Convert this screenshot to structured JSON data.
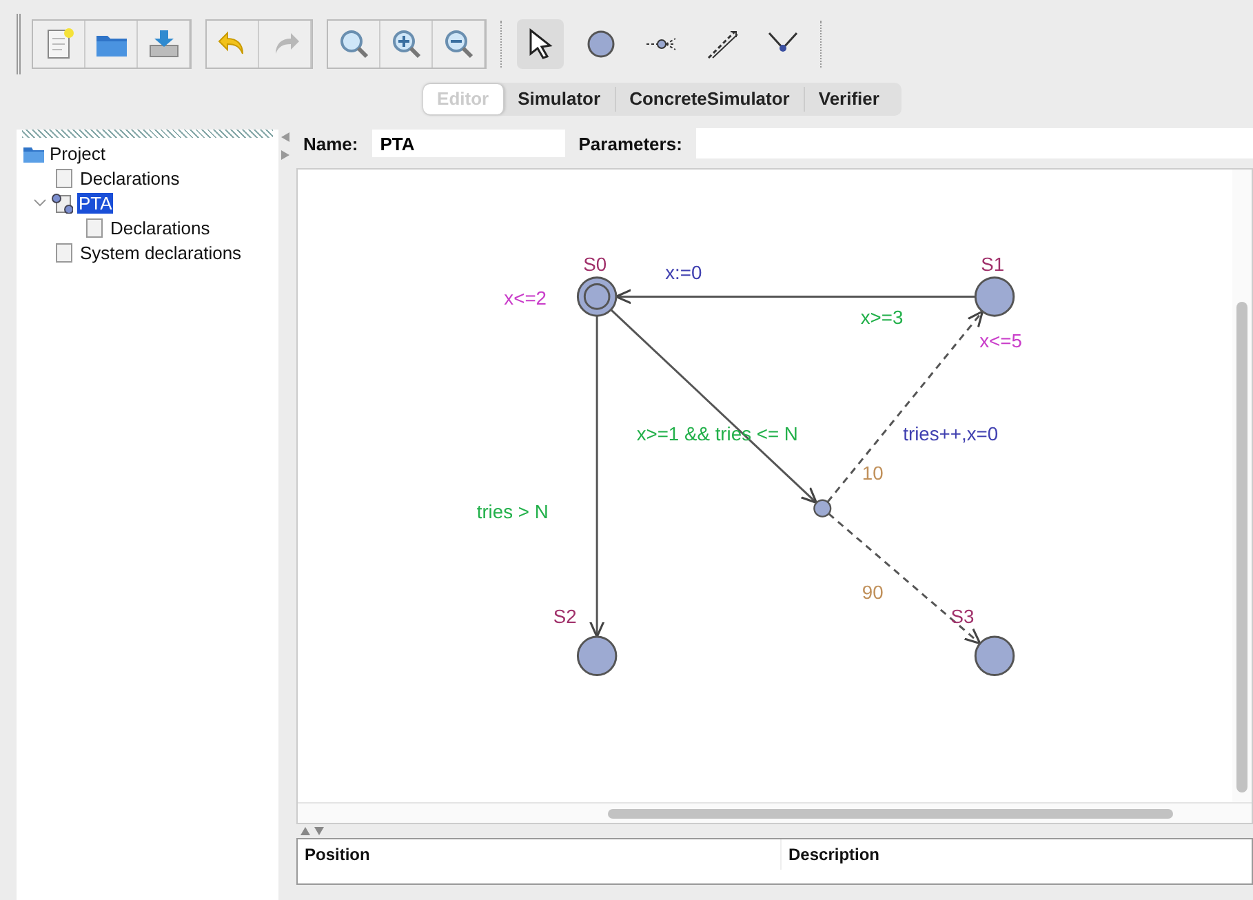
{
  "toolbar": {
    "groups": [
      [
        {
          "kind": "new",
          "disabled": false
        },
        {
          "kind": "open",
          "disabled": false
        },
        {
          "kind": "save",
          "disabled": false
        }
      ],
      [
        {
          "kind": "undo",
          "disabled": false
        },
        {
          "kind": "redo",
          "disabled": true
        }
      ],
      [
        {
          "kind": "zoom",
          "disabled": false
        },
        {
          "kind": "zoom-in",
          "disabled": false
        },
        {
          "kind": "zoom-out",
          "disabled": false
        }
      ]
    ],
    "tools": [
      {
        "kind": "select",
        "selected": true
      },
      {
        "kind": "location",
        "selected": false
      },
      {
        "kind": "branchpoint",
        "selected": false
      },
      {
        "kind": "edge",
        "selected": false
      },
      {
        "kind": "nail",
        "selected": false
      }
    ]
  },
  "tabs": [
    {
      "label": "Editor",
      "selected": true
    },
    {
      "label": "Simulator",
      "selected": false
    },
    {
      "label": "ConcreteSimulator",
      "selected": false
    },
    {
      "label": "Verifier",
      "selected": false
    }
  ],
  "tree": [
    {
      "label": "Project",
      "kind": "folder",
      "selected": false,
      "children": [
        {
          "label": "Declarations",
          "kind": "doc",
          "selected": false
        },
        {
          "label": "PTA",
          "kind": "template",
          "selected": true,
          "expanded": true,
          "children": [
            {
              "label": "Declarations",
              "kind": "doc",
              "selected": false
            }
          ]
        },
        {
          "label": "System declarations",
          "kind": "doc",
          "selected": false
        }
      ]
    }
  ],
  "template": {
    "name_label": "Name:",
    "name": "PTA",
    "parameters_label": "Parameters:"
  },
  "automaton": {
    "locations": [
      {
        "name": "S0",
        "invariant": "x<=2",
        "initial": true
      },
      {
        "name": "S1",
        "invariant": "x<=5",
        "initial": false
      },
      {
        "name": "S2",
        "initial": false
      },
      {
        "name": "S3",
        "initial": false
      }
    ],
    "edges": [
      {
        "kind": "solid",
        "guard": "x>=3",
        "update": "x:=0"
      },
      {
        "kind": "solid",
        "guard": "x>=1 && tries <= N"
      },
      {
        "kind": "dashed",
        "update": "tries++,x=0",
        "probability": "10"
      },
      {
        "kind": "dashed",
        "probability": "90"
      },
      {
        "kind": "solid",
        "guard": "tries > N"
      }
    ]
  },
  "problems": {
    "columns": [
      "Position",
      "Description"
    ]
  }
}
